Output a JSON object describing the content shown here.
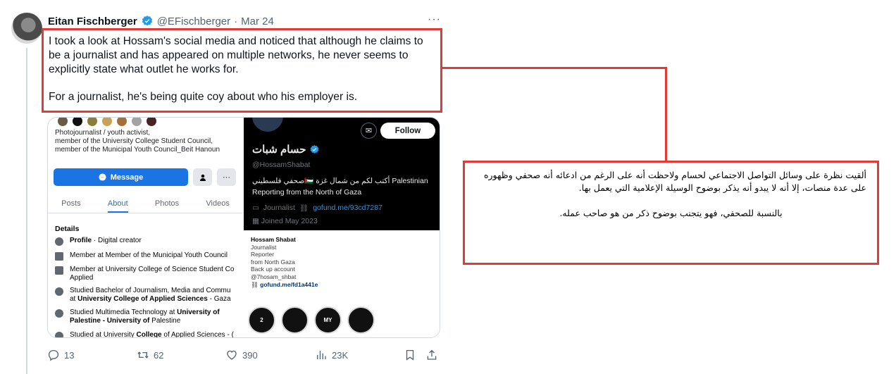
{
  "tweet": {
    "author_name": "Eitan Fischberger",
    "handle": "@EFischberger",
    "separator": "·",
    "date": "Mar 24",
    "more": "···",
    "text_p1": "I took a look at Hossam's social media and noticed that although he claims to be a journalist and has appeared on multiple networks, he never seems to explicitly state what outlet he works for.",
    "text_p2": "For a journalist, he's being quite coy about who his employer is."
  },
  "facebook": {
    "bio_1": "Photojournalist / youth activist,",
    "bio_2": "member of the University College Student Council,",
    "bio_3": "member of the Municipal Youth Council_Beit Hanoun",
    "message_label": "Message",
    "more_label": "···",
    "tabs": [
      "Posts",
      "About",
      "Photos",
      "Videos"
    ],
    "details_title": "Details",
    "rows": [
      {
        "bold": "Profile",
        "rest": " · Digital creator"
      },
      {
        "bold": "",
        "rest": "Member at Member of the Municipal Youth Council"
      },
      {
        "bold": "",
        "rest": "Member at University College of Science Student Co"
      },
      {
        "bold": "",
        "rest": "Applied"
      },
      {
        "bold": "",
        "rest": "Studied Bachelor of Journalism, Media and Commu"
      },
      {
        "bold": "University College of Applied Sciences",
        "rest": " - Gaza",
        "prefix": "at "
      },
      {
        "bold": "University of",
        "rest": "",
        "prefix": "Studied Multimedia Technology at "
      },
      {
        "bold": "Palestine - University of",
        "rest": " Palestine",
        "prefix": ""
      },
      {
        "bold": "College",
        "rest": " of Applied Sciences - (",
        "prefix": "Studied at University "
      }
    ]
  },
  "x_profile": {
    "follow_label": "Follow",
    "name": "حسام شبات",
    "handle": "@HossamShabat",
    "bio_1": "صحفي فلسطيني🇵🇸 أكتب لكم من شمال غزة Palestinian",
    "bio_2": "Reporting from the North of Gaza",
    "category": "Journalist",
    "link": "gofund.me/93cd7287",
    "joined": "Joined May 2023"
  },
  "instagram": {
    "name": "Hossam Shabat",
    "lines": [
      "Journalist",
      "Reporter",
      "from North Gaza",
      "Back up account",
      "@7hosam_shbat"
    ],
    "link": "gofund.me/fd1a441e",
    "highlights": [
      "2",
      "",
      "MY",
      ""
    ]
  },
  "actions": {
    "replies": "13",
    "reposts": "62",
    "likes": "390",
    "views": "23K"
  },
  "arabic": {
    "p1": "ألقيت نظرة على وسائل التواصل الاجتماعي لحسام ولاحظت أنه على الرغم من ادعائه أنه صحفي وظهوره على عدة منصات، إلا أنه لا يبدو أنه يذكر بوضوح الوسيلة الإعلامية التي يعمل بها.",
    "p2": "بالنسبة للصحفي، فهو يتجنب بوضوح ذكر من هو صاحب عمله."
  },
  "colors": {
    "highlight_red": "#e53935",
    "x_blue": "#1d9bf0",
    "fb_blue": "#1b74e4"
  }
}
